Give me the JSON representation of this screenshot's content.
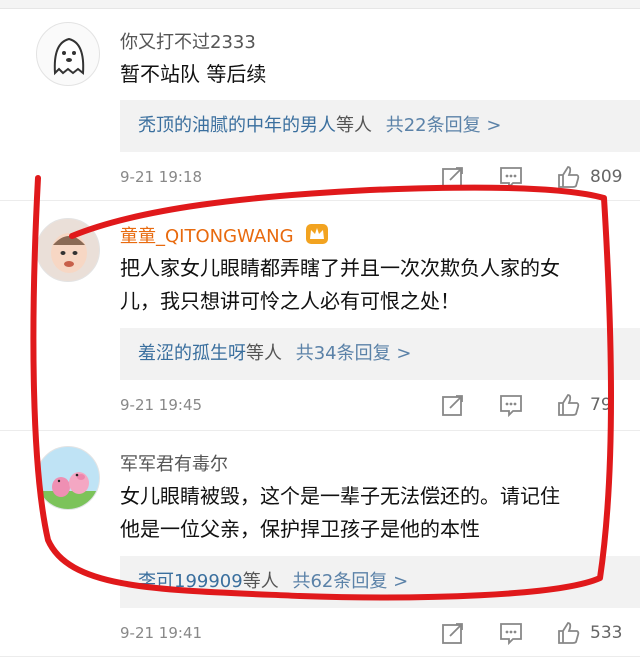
{
  "comments": [
    {
      "name": "你又打不过2333",
      "text_lines": [
        "暂不站队 等后续"
      ],
      "reply_users": "秃顶的油腻的中年的男人",
      "reply_mid": "等人",
      "reply_count": "共22条回复 >",
      "time": "9-21 19:18",
      "likes": "809",
      "avatar": "ghost-cartoon"
    },
    {
      "name": "童童_QITONGWANG",
      "text_lines": [
        "把人家女儿眼睛都弄瞎了并且一次次欺负人家的女",
        "儿，我只想讲可怜之人必有可恨之处！"
      ],
      "reply_users": "羞涩的孤生呀",
      "reply_mid": "等人",
      "reply_count": "共34条回复 >",
      "time": "9-21 19:45",
      "likes": "79",
      "avatar": "baby-photo"
    },
    {
      "name": "军军君有毒尔",
      "text_lines": [
        "女儿眼睛被毁，这个是一辈子无法偿还的。请记住",
        "他是一位父亲，保护捍卫孩子是他的本性"
      ],
      "reply_users": "李可199909",
      "reply_mid": "等人",
      "reply_count": "共62条回复 >",
      "time": "9-21 19:41",
      "likes": "533",
      "avatar": "peppa-pig"
    }
  ],
  "colors": {
    "link_blue": "#3a6f9e",
    "name_orange": "#e86a0e",
    "annotation_red": "#e0191b",
    "reply_bg": "#f2f2f2"
  },
  "icons": [
    "share-icon",
    "comment-icon",
    "thumbs-up-icon",
    "crown-badge-icon"
  ]
}
